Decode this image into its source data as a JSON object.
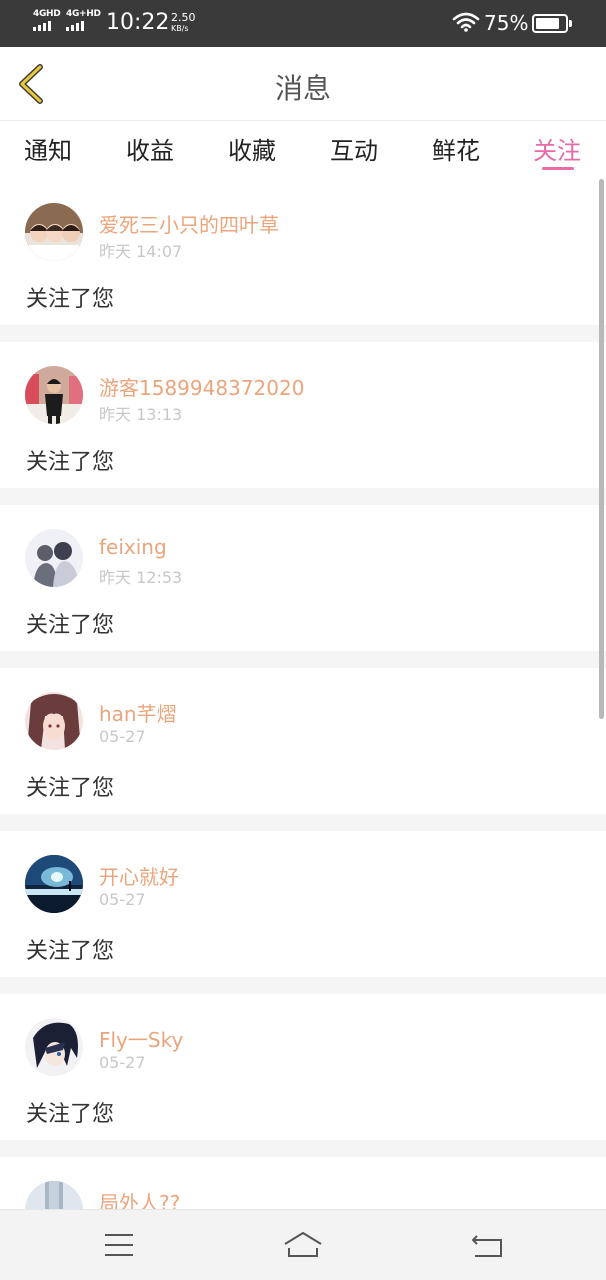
{
  "status_bar": {
    "sim1": "4GHD",
    "sim2": "4G+HD",
    "time": "10:22",
    "speed_value": "2.50",
    "speed_unit": "KB/s",
    "battery": "75%",
    "battery_level": 0.75
  },
  "header": {
    "title": "消息",
    "back_icon": "chevron-left-icon"
  },
  "tabs": [
    {
      "label": "通知",
      "active": false
    },
    {
      "label": "收益",
      "active": false
    },
    {
      "label": "收藏",
      "active": false
    },
    {
      "label": "互动",
      "active": false
    },
    {
      "label": "鲜花",
      "active": false
    },
    {
      "label": "关注",
      "active": true
    }
  ],
  "messages": [
    {
      "name": "爱死三小只的四叶草",
      "time": "昨天 14:07",
      "text": "关注了您"
    },
    {
      "name": "游客1589948372020",
      "time": "昨天 13:13",
      "text": "关注了您"
    },
    {
      "name": "feixing",
      "time": "昨天 12:53",
      "text": "关注了您"
    },
    {
      "name": "han芊熠",
      "time": "05-27",
      "text": "关注了您"
    },
    {
      "name": "开心就好",
      "time": "05-27",
      "text": "关注了您"
    },
    {
      "name": "Fly一Sky",
      "time": "05-27",
      "text": "关注了您"
    },
    {
      "name": "局外人??",
      "time": "",
      "text": ""
    }
  ],
  "nav": {
    "menu_icon": "menu-icon",
    "home_icon": "home-icon",
    "back_icon": "back-arrow-icon"
  },
  "colors": {
    "accent": "#e86aa6",
    "username": "#eba57c",
    "back_arrow": "#e8c93a"
  }
}
